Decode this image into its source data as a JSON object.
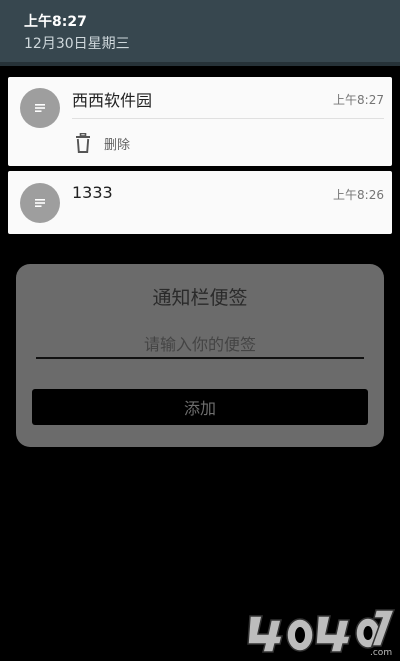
{
  "status_shade": {
    "time": "上午8:27",
    "date": "12月30日星期三"
  },
  "notifications": [
    {
      "title": "西西软件园",
      "time": "上午8:27",
      "icon": "notes-icon",
      "action": {
        "icon": "trash-icon",
        "label": "删除"
      }
    },
    {
      "title": "1333",
      "time": "上午8:26",
      "icon": "notes-icon"
    }
  ],
  "dialog": {
    "title": "通知栏便签",
    "input_placeholder": "请输入你的便签",
    "input_value": "",
    "add_button_label": "添加"
  },
  "watermark": {
    "text": "4O4O7.com"
  },
  "colors": {
    "shade": "#37474f",
    "card": "#fafafa",
    "icon_circle": "#9e9e9e",
    "dialog": "#6b6b6b",
    "background": "#000000"
  }
}
